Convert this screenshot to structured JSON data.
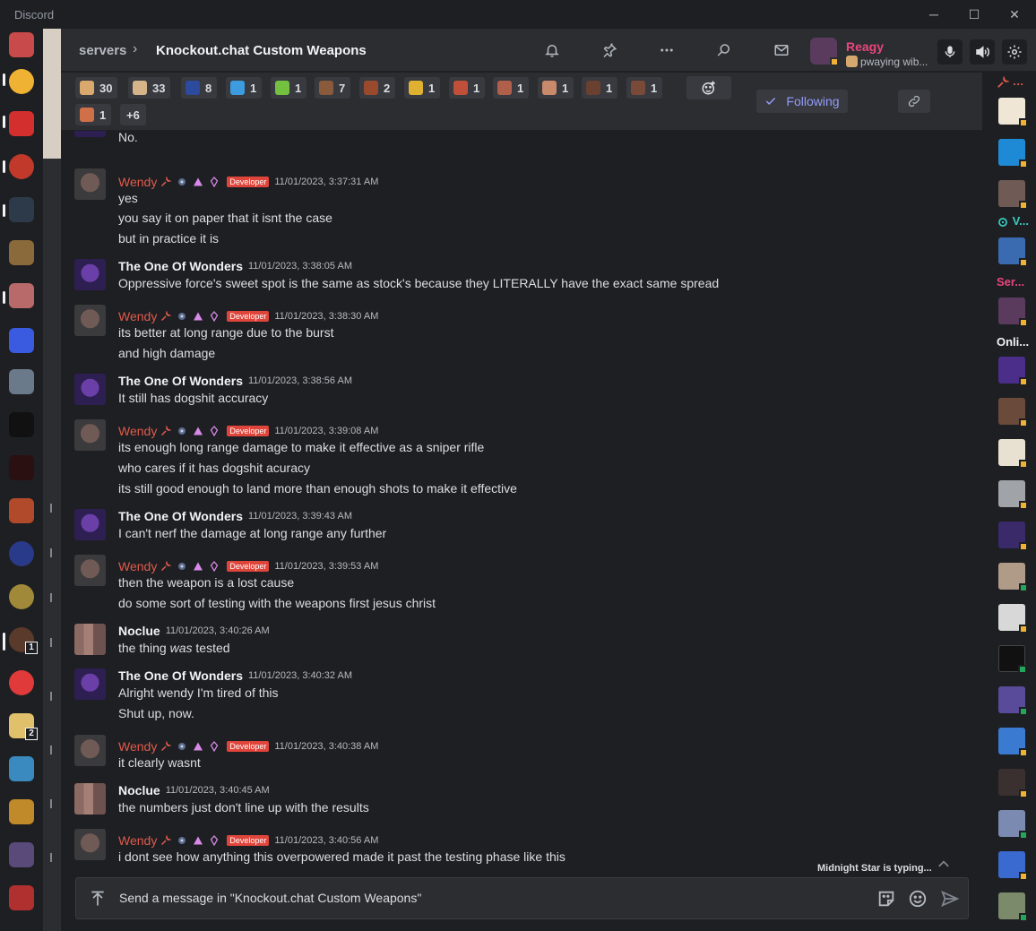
{
  "app": {
    "title": "Discord"
  },
  "window_controls": {
    "minimize": "─",
    "maximize": "☐",
    "close": "✕"
  },
  "header": {
    "breadcrumb_root": "servers",
    "breadcrumb_sep": "›",
    "channel_name": "Knockout.chat Custom Weapons"
  },
  "user": {
    "name": "Reagy",
    "status": "pwaying wib..."
  },
  "server_badges": {
    "b1": "1",
    "b2": "2"
  },
  "reactions": [
    {
      "count": "30",
      "color": "#d9a86c"
    },
    {
      "count": "33",
      "color": "#d6b48a"
    },
    {
      "count": "8",
      "color": "#2c4a9e"
    },
    {
      "count": "1",
      "color": "#3d9be0"
    },
    {
      "count": "1",
      "color": "#74c040"
    },
    {
      "count": "7",
      "color": "#8a5a3c"
    },
    {
      "count": "2",
      "color": "#9a4a2c"
    },
    {
      "count": "1",
      "color": "#e0b030"
    },
    {
      "count": "1",
      "color": "#c0503a"
    },
    {
      "count": "1",
      "color": "#b0604a"
    },
    {
      "count": "1",
      "color": "#c88a6a"
    },
    {
      "count": "1",
      "color": "#6a4030"
    },
    {
      "count": "1",
      "color": "#7a4a38"
    },
    {
      "count": "1",
      "color": "#d07048"
    }
  ],
  "reactions_more": "+6",
  "follow": {
    "label": "Following"
  },
  "messages": {
    "m0": {
      "text": "No."
    },
    "m1": {
      "author": "Wendy",
      "tag": "Developer",
      "time": "11/01/2023, 3:37:31 AM",
      "l1": "yes",
      "l2": "you say it on paper that it isnt the case",
      "l3": "but in practice it is"
    },
    "m2": {
      "author": "The One Of Wonders",
      "time": "11/01/2023, 3:38:05 AM",
      "l1": "Oppressive force's sweet spot is the same as stock's because they LITERALLY have the exact same spread"
    },
    "m3": {
      "author": "Wendy",
      "tag": "Developer",
      "time": "11/01/2023, 3:38:30 AM",
      "l1": "its better at long range due to the burst",
      "l2": "and high damage"
    },
    "m4": {
      "author": "The One Of Wonders",
      "time": "11/01/2023, 3:38:56 AM",
      "l1": "It still has dogshit accuracy"
    },
    "m5": {
      "author": "Wendy",
      "tag": "Developer",
      "time": "11/01/2023, 3:39:08 AM",
      "l1": "its enough long range damage to make it effective as a sniper rifle",
      "l2": "who cares if it has dogshit acuracy",
      "l3": "its still good enough to land more than enough shots to make it effective"
    },
    "m6": {
      "author": "The One Of Wonders",
      "time": "11/01/2023, 3:39:43 AM",
      "l1": "I can't nerf the damage at long range any further"
    },
    "m7": {
      "author": "Wendy",
      "tag": "Developer",
      "time": "11/01/2023, 3:39:53 AM",
      "l1": "then the weapon is a lost cause",
      "l2": "do some sort of testing with the weapons first jesus christ"
    },
    "m8": {
      "author": "Noclue",
      "time": "11/01/2023, 3:40:26 AM",
      "l1_pre": "the thing ",
      "l1_em": "was",
      "l1_post": " tested"
    },
    "m9": {
      "author": "The One Of Wonders",
      "time": "11/01/2023, 3:40:32 AM",
      "l1": "Alright wendy I'm tired of this",
      "l2": "Shut up, now."
    },
    "m10": {
      "author": "Wendy",
      "tag": "Developer",
      "time": "11/01/2023, 3:40:38 AM",
      "l1": "it clearly wasnt"
    },
    "m11": {
      "author": "Noclue",
      "time": "11/01/2023, 3:40:45 AM",
      "l1": "the numbers just don't line up with the results"
    },
    "m12": {
      "author": "Wendy",
      "tag": "Developer",
      "time": "11/01/2023, 3:40:56 AM",
      "l1": "i dont see how anything this overpowered made it past the testing phase like this"
    }
  },
  "typing": "Midnight Star is typing...",
  "composer": {
    "placeholder": "Send a message in \"Knockout.chat Custom Weapons\""
  },
  "members": {
    "role_top": "…",
    "role_v": "V...",
    "role_ser": "Ser...",
    "role_online": "Onli..."
  },
  "colors": {
    "accent": "#949cf7",
    "wendy_name": "#e05a4c",
    "user_name": "#e8467c",
    "developer_tag": "#e0453b",
    "status_idle": "#f0b232",
    "status_online": "#23a55a"
  }
}
